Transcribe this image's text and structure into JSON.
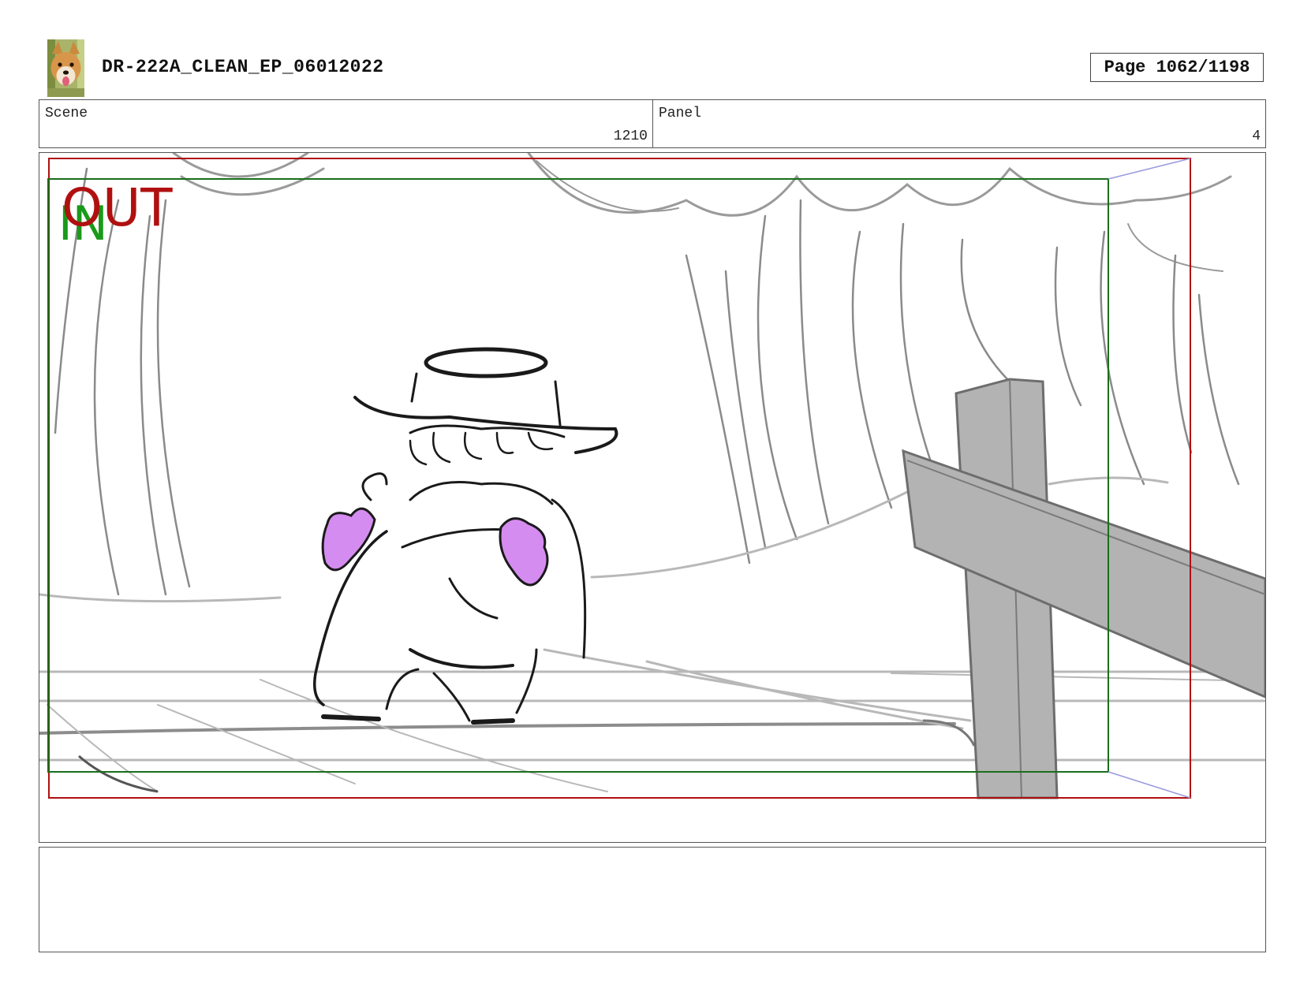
{
  "header": {
    "title": "DR-222A_CLEAN_EP_06012022",
    "page_label": "Page 1062/1198",
    "logo": "dog-photo-logo"
  },
  "info": {
    "scene_label": "Scene",
    "scene_value": "1210",
    "panel_label": "Panel",
    "panel_value": "4"
  },
  "frame": {
    "out_label": "OUT",
    "in_label": "IN",
    "out_color": "#b01010",
    "in_color": "#1a9a1a",
    "glove_color": "#d58cf0",
    "fence_color": "#b3b3b3"
  },
  "notes": {
    "text": ""
  }
}
